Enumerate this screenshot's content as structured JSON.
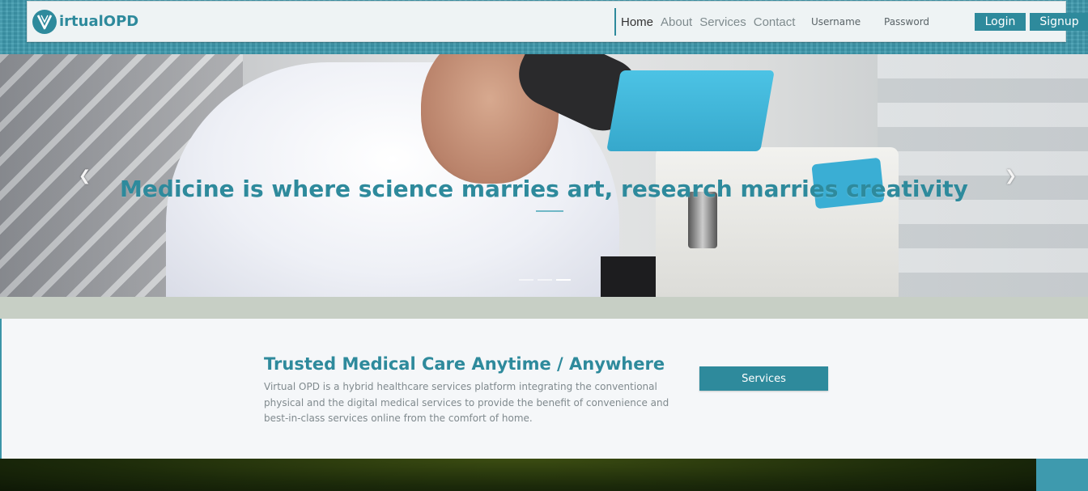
{
  "brand": {
    "logo_letter": "V",
    "name": "irtualOPD"
  },
  "nav": {
    "links": [
      "Home",
      "About",
      "Services",
      "Contact"
    ],
    "active": "Home"
  },
  "auth": {
    "username_placeholder": "Username",
    "password_placeholder": "Password",
    "login_label": "Login",
    "signup_label": "Signup"
  },
  "hero": {
    "caption": "Medicine is where science marries art, research marries creativity",
    "prev_icon": "chevron-left-icon",
    "next_icon": "chevron-right-icon",
    "slide_count": 3,
    "active_slide": 3
  },
  "info": {
    "title": "Trusted Medical Care Anytime / Anywhere",
    "description": "Virtual OPD is a hybrid healthcare services platform integrating the conventional physical and the digital medical services to provide the benefit of convenience and best-in-class services online from the comfort of home.",
    "button_label": "Services"
  },
  "colors": {
    "accent": "#2e8a9c",
    "background": "#3e9aae",
    "navbar": "#eef3f4",
    "info_bg": "#f5f7f9",
    "band": "#c7cfc5"
  }
}
